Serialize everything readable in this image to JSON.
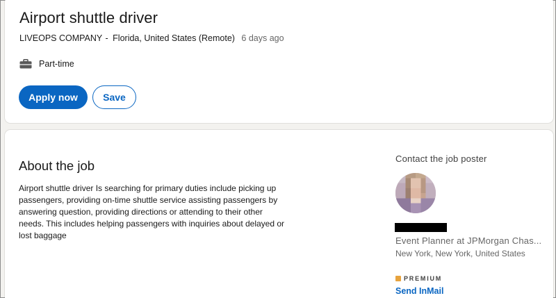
{
  "job": {
    "title": "Airport shuttle driver",
    "company": "LIVEOPS COMPANY",
    "separator": "-",
    "location": "Florida, United States (Remote)",
    "posted": "6 days ago",
    "job_type": "Part-time",
    "job_type_icon": "briefcase-icon"
  },
  "actions": {
    "apply_label": "Apply now",
    "save_label": "Save"
  },
  "about": {
    "heading": "About the job",
    "body": "Airport shuttle driver Is searching for primary duties include picking up passengers, providing on-time shuttle service assisting passengers by answering question, providing directions or attending to their other needs. This includes helping passengers with inquiries about delayed or lost baggage"
  },
  "contact": {
    "heading": "Contact the job poster",
    "avatar_icon": "avatar-pixelated",
    "headline": "Event Planner at JPMorgan Chas...",
    "location": "New York, New York, United States",
    "premium_label": "PREMIUM",
    "inmail_label": "Send InMail"
  },
  "colors": {
    "accent": "#0a66c2",
    "premium": "#e7a33e",
    "background": "#f3f2ef"
  }
}
